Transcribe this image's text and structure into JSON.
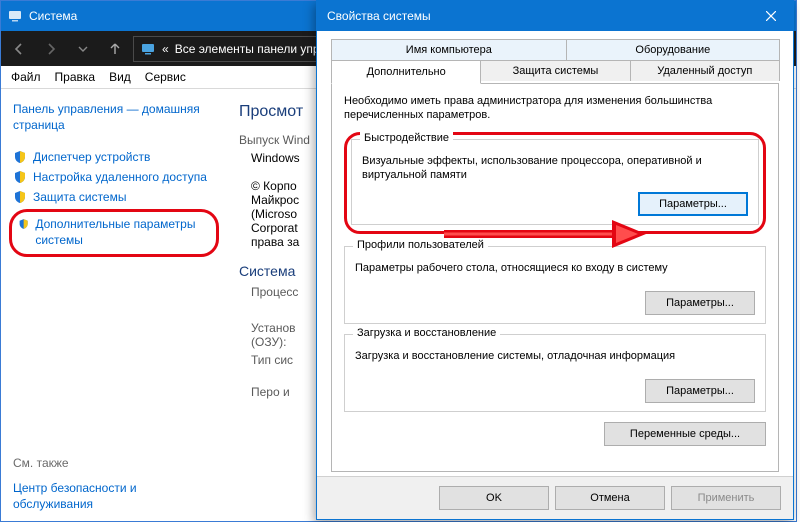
{
  "system_window": {
    "title": "Система",
    "breadcrumb_prefix": "«",
    "breadcrumb": "Все элементы панели упр",
    "menu": {
      "file": "Файл",
      "edit": "Правка",
      "view": "Вид",
      "service": "Сервис"
    },
    "sidebar": {
      "home": "Панель управления — домашняя страница",
      "items": [
        {
          "label": "Диспетчер устройств"
        },
        {
          "label": "Настройка удаленного доступа"
        },
        {
          "label": "Защита системы"
        },
        {
          "label": "Дополнительные параметры системы"
        }
      ],
      "see_also_header": "См. также",
      "see_also": "Центр безопасности и обслуживания"
    },
    "main": {
      "heading": "Просмот",
      "edition_label": "Выпуск Wind",
      "edition_value": "Windows",
      "copyright": "© Корпо\nМайкрос\n(Microso\nCorporat\nправа за",
      "sect_system": "Система",
      "cpu_label": "Процесс",
      "ram_label": "Установ\n(ОЗУ):",
      "type_label": "Тип сис",
      "pen_label": "Перо и"
    }
  },
  "dialog": {
    "title": "Свойства системы",
    "tabs_row1": {
      "name": "Имя компьютера",
      "hardware": "Оборудование"
    },
    "tabs_row2": {
      "advanced": "Дополнительно",
      "protection": "Защита системы",
      "remote": "Удаленный доступ"
    },
    "intro": "Необходимо иметь права администратора для изменения большинства перечисленных параметров.",
    "groups": {
      "performance": {
        "legend": "Быстродействие",
        "desc": "Визуальные эффекты, использование процессора, оперативной и виртуальной памяти",
        "button": "Параметры..."
      },
      "profiles": {
        "legend": "Профили пользователей",
        "desc": "Параметры рабочего стола, относящиеся ко входу в систему",
        "button": "Параметры..."
      },
      "startup": {
        "legend": "Загрузка и восстановление",
        "desc": "Загрузка и восстановление системы, отладочная информация",
        "button": "Параметры..."
      }
    },
    "env_button": "Переменные среды...",
    "buttons": {
      "ok": "OK",
      "cancel": "Отмена",
      "apply": "Применить"
    }
  }
}
